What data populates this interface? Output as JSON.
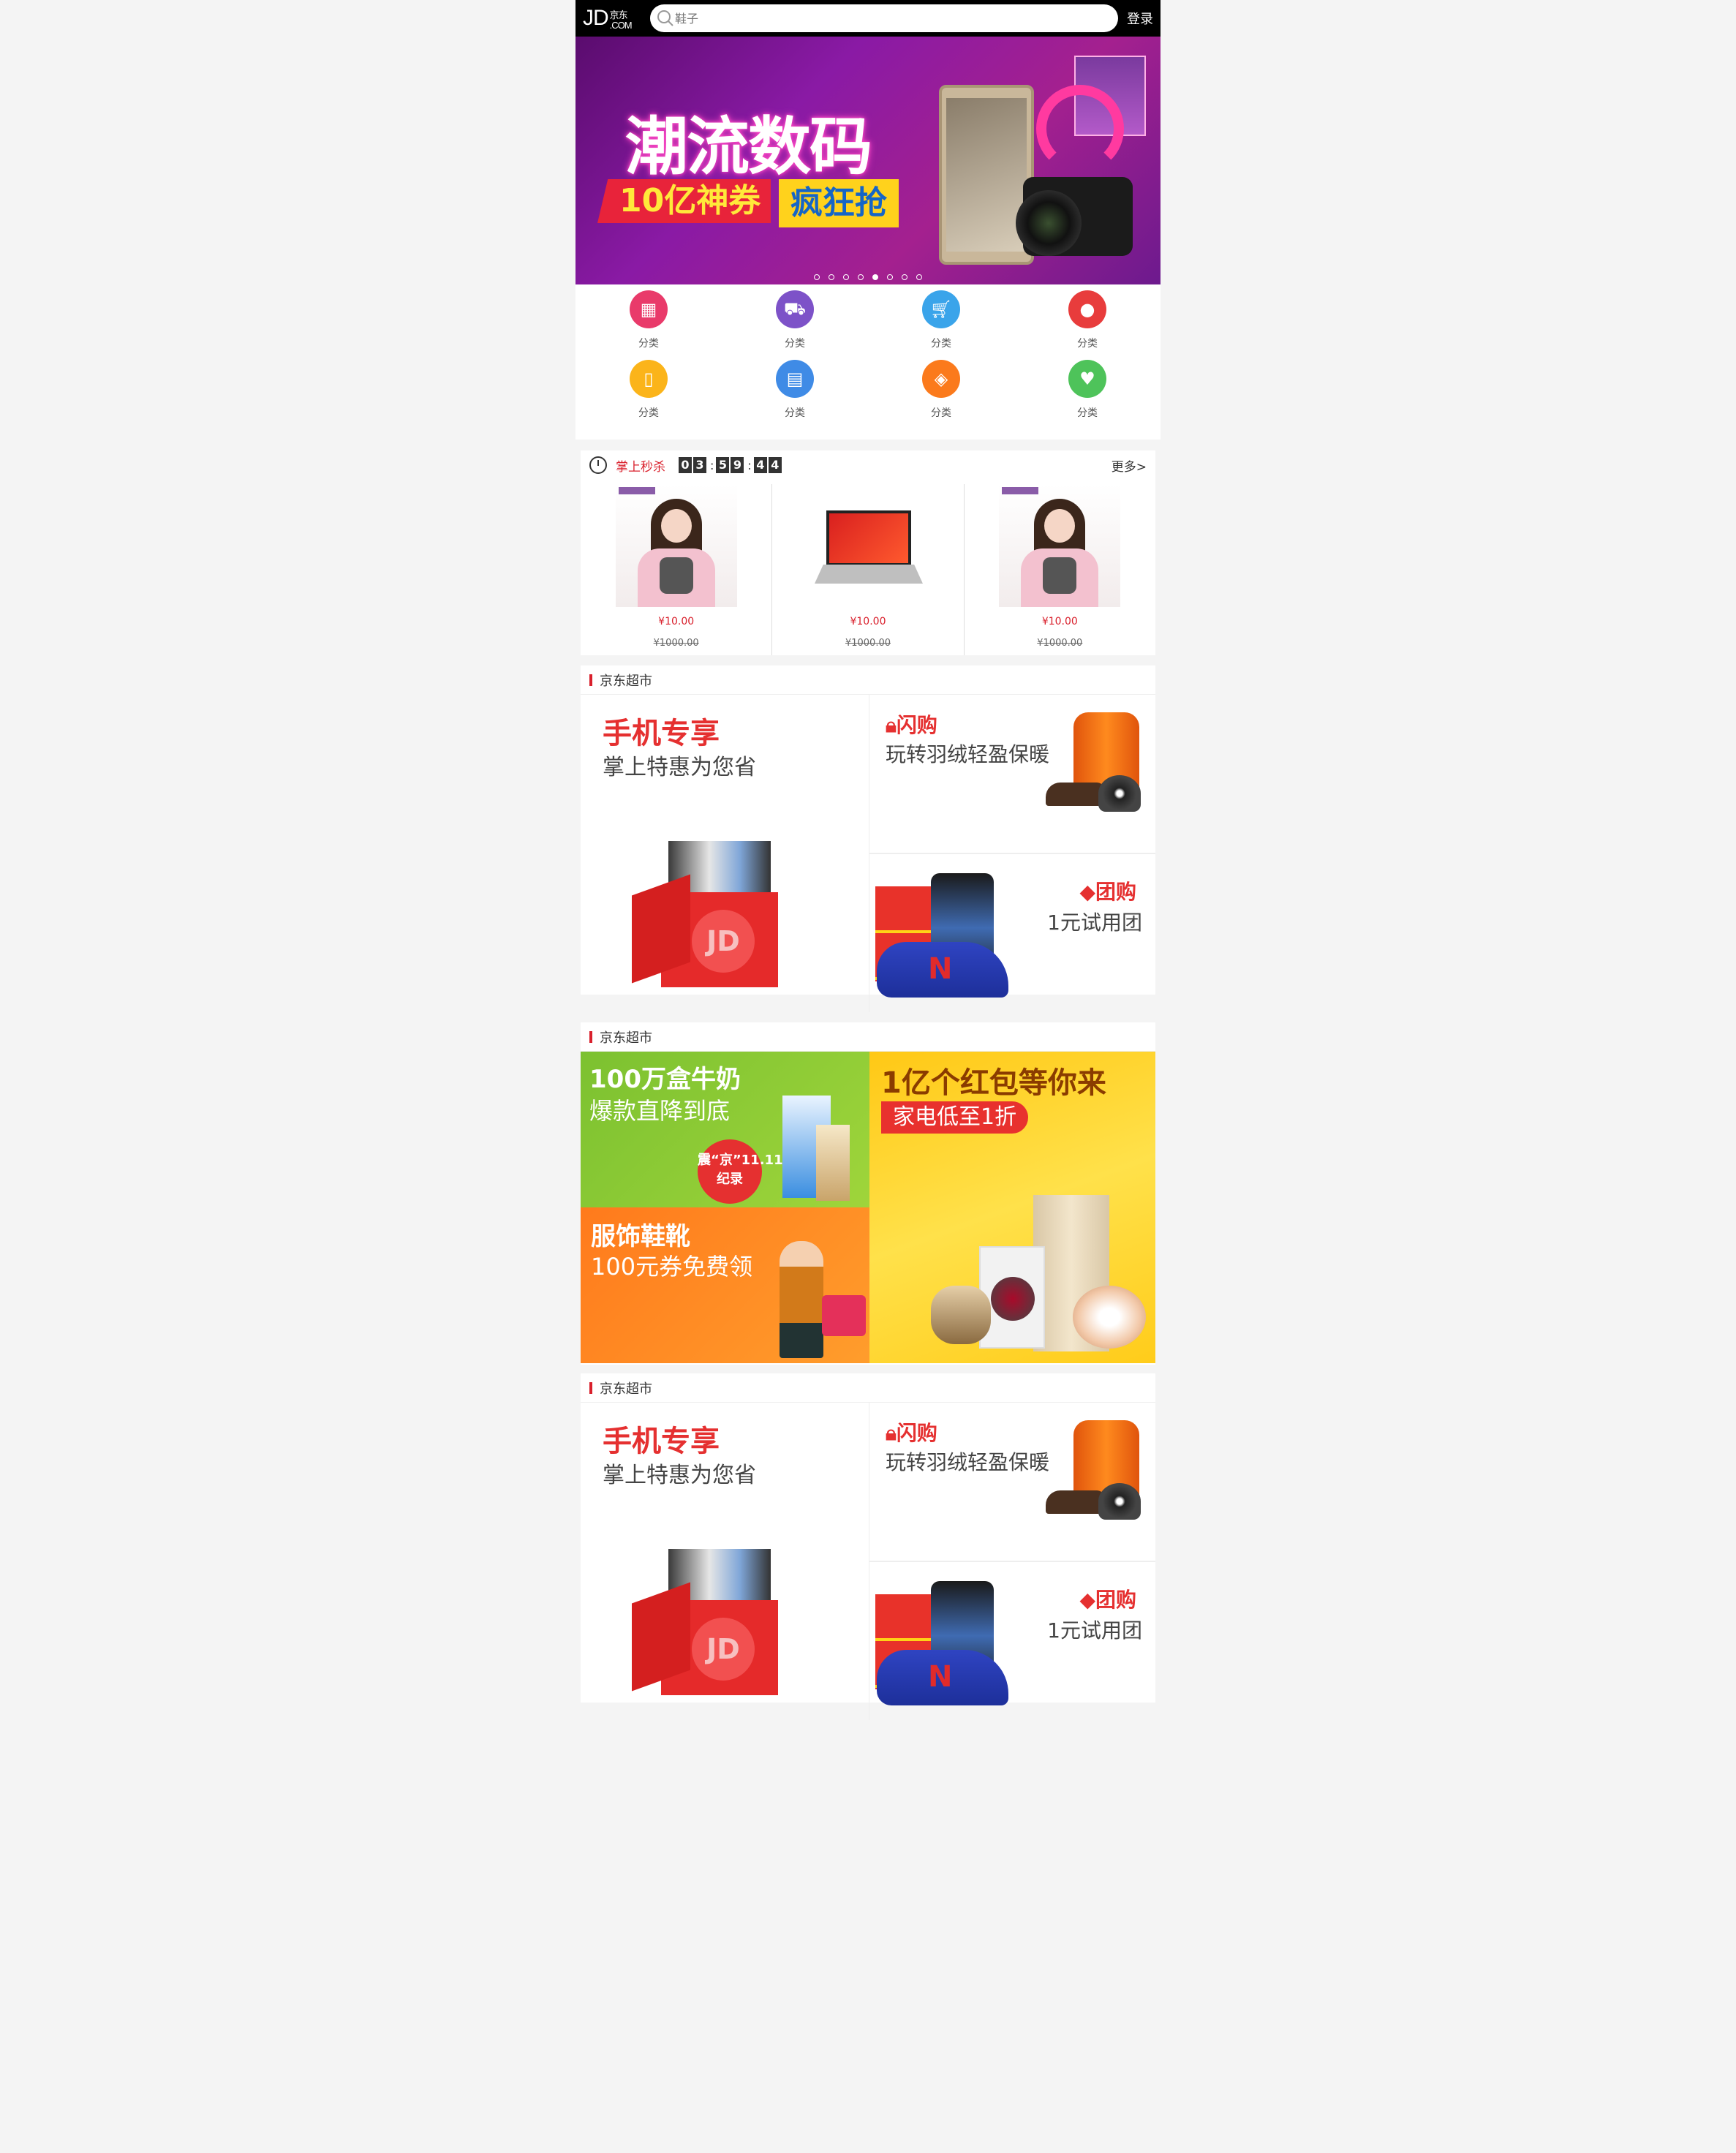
{
  "header": {
    "logo_text": "JD",
    "logo_sub": ".COM",
    "logo_cn": "京东",
    "search_placeholder": "鞋子",
    "login_label": "登录"
  },
  "banner": {
    "title": "潮流数码",
    "tag1": "10亿神券",
    "tag2": "疯狂抢",
    "dots": 8,
    "active_dot": 5
  },
  "nav": {
    "items": [
      {
        "label": "分类",
        "icon": "grid-icon",
        "color": "#e93a6a"
      },
      {
        "label": "分类",
        "icon": "truck-icon",
        "color": "#7d52c8"
      },
      {
        "label": "分类",
        "icon": "cart-icon",
        "color": "#3aa4ea"
      },
      {
        "label": "分类",
        "icon": "user-icon",
        "color": "#e83c3c"
      },
      {
        "label": "分类",
        "icon": "phone-icon",
        "color": "#fbb41a"
      },
      {
        "label": "分类",
        "icon": "ticket-icon",
        "color": "#3f8be6"
      },
      {
        "label": "分类",
        "icon": "tag-icon",
        "color": "#fb7a1c"
      },
      {
        "label": "分类",
        "icon": "heart-icon",
        "color": "#4ec35a"
      }
    ]
  },
  "flash_sale": {
    "title": "掌上秒杀",
    "timer": [
      "0",
      "3",
      "5",
      "9",
      "4",
      "4"
    ],
    "separator": ":",
    "more_label": "更多>",
    "products": [
      {
        "price": "¥10.00",
        "old_price": "¥1000.00"
      },
      {
        "price": "¥10.00",
        "old_price": "¥1000.00"
      },
      {
        "price": "¥10.00",
        "old_price": "¥1000.00"
      }
    ]
  },
  "section1": {
    "title": "京东超市",
    "phone_title": "手机专享",
    "phone_sub": "掌上特惠为您省",
    "gift_logo": "JD",
    "flash_title": "闪购",
    "flash_sub": "玩转羽绒轻盈保暖",
    "group_title": "团购",
    "group_sub": "1元试用团"
  },
  "section2": {
    "title": "京东超市",
    "milk_title": "100万盒牛奶",
    "milk_sub": "爆款直降到底",
    "milk_stamp": "震“京”11.11纪录",
    "cloth_title": "服饰鞋靴",
    "cloth_sub": "100元券免费领",
    "hb_title": "1亿个红包等你来",
    "hb_sub": "家电低至1折"
  },
  "section3": {
    "title": "京东超市",
    "phone_title": "手机专享",
    "phone_sub": "掌上特惠为您省",
    "gift_logo": "JD",
    "flash_title": "闪购",
    "flash_sub": "玩转羽绒轻盈保暖",
    "group_title": "团购",
    "group_sub": "1元试用团"
  }
}
